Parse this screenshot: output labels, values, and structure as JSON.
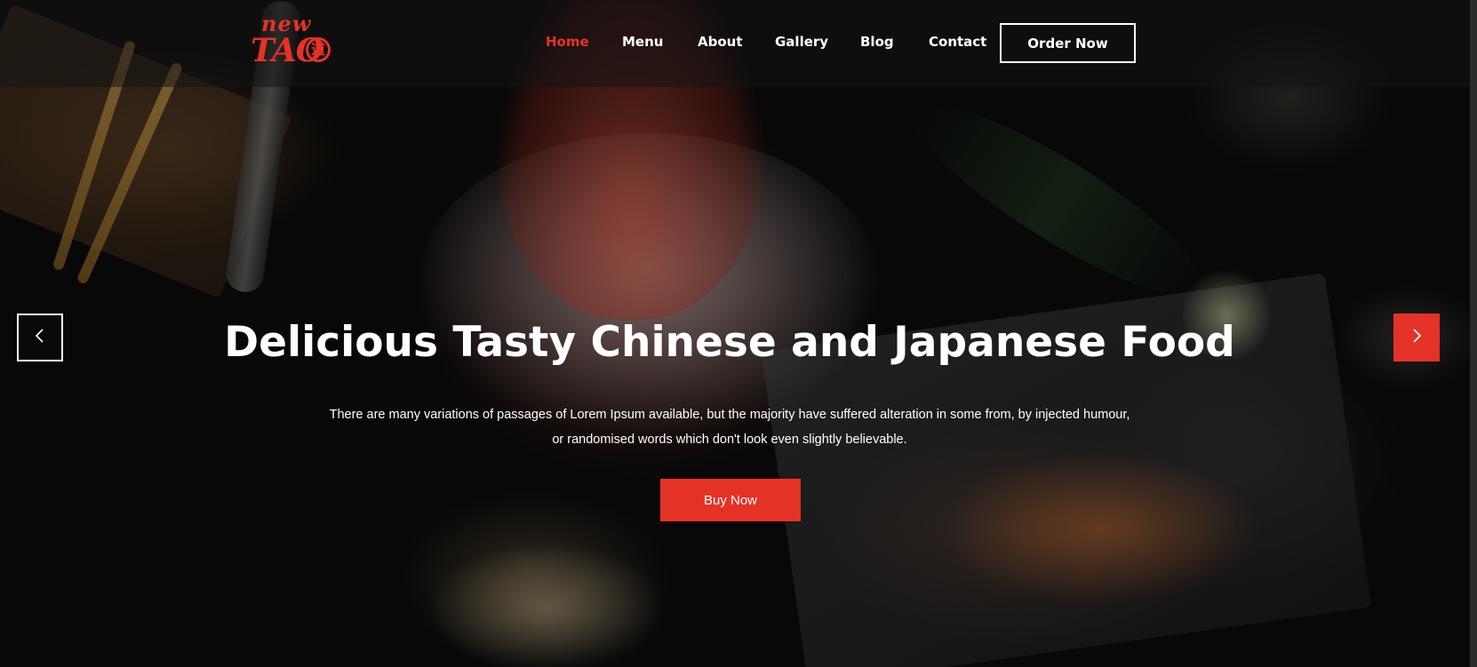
{
  "brand": {
    "logo_top": "new",
    "logo_main": "TAO",
    "logo_seal": "道"
  },
  "nav": {
    "items": [
      {
        "label": "Home",
        "active": true
      },
      {
        "label": "Menu",
        "active": false
      },
      {
        "label": "About",
        "active": false
      },
      {
        "label": "Gallery",
        "active": false
      },
      {
        "label": "Blog",
        "active": false
      },
      {
        "label": "Contact",
        "active": false
      }
    ],
    "cta_label": "Order Now"
  },
  "hero": {
    "headline": "Delicious Tasty Chinese and Japanese Food",
    "subtext_line1": "There are many variations of passages of Lorem Ipsum available, but the majority have suffered alteration in some from, by injected humour,",
    "subtext_line2": "or randomised words which don't look even slightly believable.",
    "button_label": "Buy Now"
  },
  "carousel": {
    "prev_icon": "chevron-left-icon",
    "next_icon": "chevron-right-icon"
  },
  "colors": {
    "accent": "#e53227",
    "text": "#ffffff",
    "header_bg": "#141414"
  }
}
